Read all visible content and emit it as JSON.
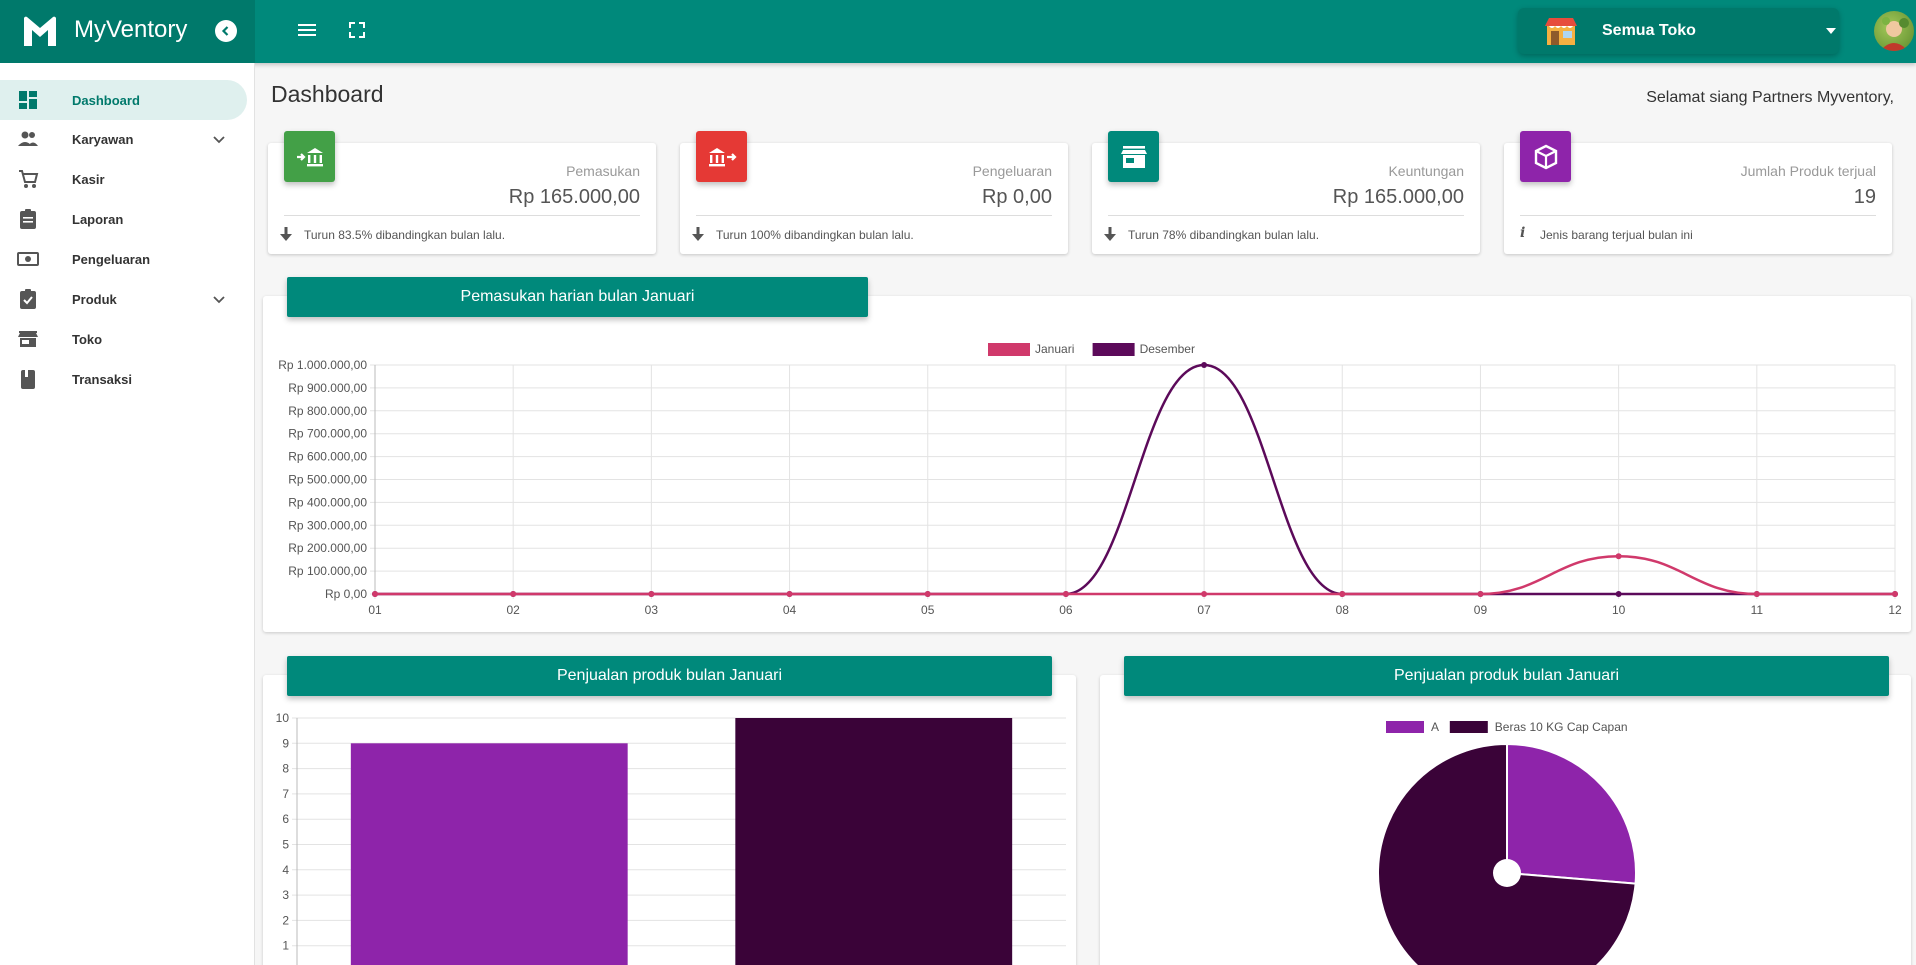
{
  "app": {
    "name": "MyVentory"
  },
  "topbar": {
    "store_selector": "Semua Toko"
  },
  "sidebar": {
    "items": [
      {
        "label": "Dashboard",
        "icon": "dashboard-icon",
        "active": true
      },
      {
        "label": "Karyawan",
        "icon": "people-icon",
        "expandable": true
      },
      {
        "label": "Kasir",
        "icon": "cart-icon"
      },
      {
        "label": "Laporan",
        "icon": "clipboard-icon"
      },
      {
        "label": "Pengeluaran",
        "icon": "money-icon"
      },
      {
        "label": "Produk",
        "icon": "checklist-icon",
        "expandable": true
      },
      {
        "label": "Toko",
        "icon": "store-icon"
      },
      {
        "label": "Transaksi",
        "icon": "book-icon"
      }
    ]
  },
  "page": {
    "title": "Dashboard",
    "greeting": "Selamat siang Partners Myventory,"
  },
  "stats": [
    {
      "label": "Pemasukan",
      "value": "Rp 165.000,00",
      "foot": "Turun 83.5% dibandingkan bulan lalu.",
      "color": "#43a047",
      "icon": "income-bank-icon"
    },
    {
      "label": "Pengeluaran",
      "value": "Rp 0,00",
      "foot": "Turun 100% dibandingkan bulan lalu.",
      "color": "#e53935",
      "icon": "expense-bank-icon"
    },
    {
      "label": "Keuntungan",
      "value": "Rp 165.000,00",
      "foot": "Turun 78% dibandingkan bulan lalu.",
      "color": "#00897b",
      "icon": "storefront-icon"
    },
    {
      "label": "Jumlah Produk terjual",
      "value": "19",
      "foot": "Jenis barang terjual bulan ini",
      "color": "#8e24aa",
      "icon": "box-icon"
    }
  ],
  "panels": {
    "daily": {
      "title": "Pemasukan harian bulan Januari"
    },
    "bar": {
      "title": "Penjualan produk bulan Januari"
    },
    "pie": {
      "title": "Penjualan produk bulan Januari"
    }
  },
  "chart_data": [
    {
      "type": "line",
      "x": [
        "01",
        "02",
        "03",
        "04",
        "05",
        "06",
        "07",
        "08",
        "09",
        "10",
        "11",
        "12"
      ],
      "series": [
        {
          "name": "Januari",
          "color": "#d0396b",
          "values": [
            0,
            0,
            0,
            0,
            0,
            0,
            0,
            0,
            0,
            165000,
            0,
            0
          ]
        },
        {
          "name": "Desember",
          "color": "#5c0a5a",
          "values": [
            0,
            0,
            0,
            0,
            0,
            0,
            1000000,
            0,
            0,
            0,
            0,
            0
          ]
        }
      ],
      "ylim": [
        0,
        1000000
      ],
      "yticks": [
        "Rp 0,00",
        "Rp 100.000,00",
        "Rp 200.000,00",
        "Rp 300.000,00",
        "Rp 400.000,00",
        "Rp 500.000,00",
        "Rp 600.000,00",
        "Rp 700.000,00",
        "Rp 800.000,00",
        "Rp 900.000,00",
        "Rp 1.000.000,00"
      ],
      "legend": "top-center",
      "grid": true
    },
    {
      "type": "bar",
      "categories": [
        "A",
        "Beras 10 KG Cap Capan"
      ],
      "values": [
        9,
        10
      ],
      "colors": [
        "#8e24aa",
        "#3a0338"
      ],
      "ylim": [
        0,
        10
      ],
      "yticks": [
        1,
        2,
        3,
        4,
        5,
        6,
        7,
        8,
        9,
        10
      ],
      "grid": true
    },
    {
      "type": "pie",
      "labels": [
        "A",
        "Beras 10 KG Cap Capan"
      ],
      "values": [
        5,
        14
      ],
      "colors": [
        "#8e24aa",
        "#3a0338"
      ],
      "legend": "top-center"
    }
  ]
}
